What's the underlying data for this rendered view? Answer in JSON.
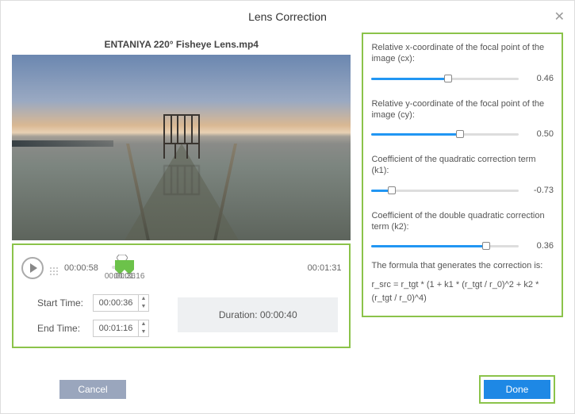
{
  "dialog": {
    "title": "Lens Correction",
    "close_glyph": "✕"
  },
  "video": {
    "filename": "ENTANIYA 220° Fisheye Lens.mp4"
  },
  "playback": {
    "current_time": "00:00:58",
    "total_time": "00:01:31",
    "range_start_label": "00:00:36",
    "range_end_label": "00:01:16",
    "playhead_pct": 50,
    "range_start_pct": 39,
    "range_end_pct": 83
  },
  "time_inputs": {
    "start_label": "Start Time:",
    "start_value": "00:00:36",
    "end_label": "End Time:",
    "end_value": "00:01:16",
    "duration_label": "Duration:",
    "duration_value": "00:00:40"
  },
  "params": [
    {
      "label": "Relative x-coordinate of the focal point of the image (cx):",
      "fill_pct": 52,
      "thumb_pct": 52,
      "value": "0.46"
    },
    {
      "label": "Relative y-coordinate of the focal point of the image (cy):",
      "fill_pct": 60,
      "thumb_pct": 60,
      "value": "0.50"
    },
    {
      "label": "Coefficient of the quadratic correction term (k1):",
      "fill_pct": 14,
      "thumb_pct": 14,
      "value": "-0.73"
    },
    {
      "label": "Coefficient of the double quadratic correction term (k2):",
      "fill_pct": 78,
      "thumb_pct": 78,
      "value": "0.36"
    }
  ],
  "formula": {
    "label": "The formula that generates the correction is:",
    "text": "r_src = r_tgt * (1 + k1 * (r_tgt / r_0)^2 + k2 * (r_tgt / r_0)^4)"
  },
  "buttons": {
    "cancel": "Cancel",
    "done": "Done"
  }
}
